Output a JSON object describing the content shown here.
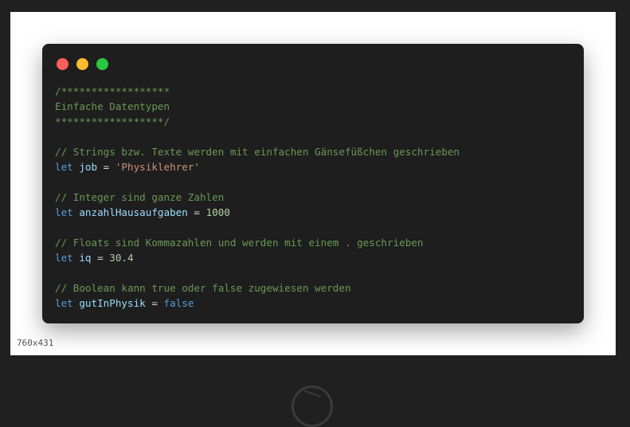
{
  "window": {
    "dots": [
      {
        "name": "close",
        "color": "#ff5f57"
      },
      {
        "name": "minimize",
        "color": "#febc2e"
      },
      {
        "name": "maximize",
        "color": "#28c840"
      }
    ]
  },
  "code": {
    "lines": [
      [
        {
          "t": "comment",
          "v": "/******************"
        }
      ],
      [
        {
          "t": "comment",
          "v": "Einfache Datentypen"
        }
      ],
      [
        {
          "t": "comment",
          "v": "******************/"
        }
      ],
      [],
      [
        {
          "t": "comment",
          "v": "// Strings bzw. Texte werden mit einfachen Gänsefüßchen geschrieben"
        }
      ],
      [
        {
          "t": "keyword",
          "v": "let"
        },
        {
          "t": "op",
          "v": " "
        },
        {
          "t": "ident",
          "v": "job"
        },
        {
          "t": "op",
          "v": " = "
        },
        {
          "t": "string",
          "v": "'Physiklehrer'"
        }
      ],
      [],
      [
        {
          "t": "comment",
          "v": "// Integer sind ganze Zahlen"
        }
      ],
      [
        {
          "t": "keyword",
          "v": "let"
        },
        {
          "t": "op",
          "v": " "
        },
        {
          "t": "ident",
          "v": "anzahlHausaufgaben"
        },
        {
          "t": "op",
          "v": " = "
        },
        {
          "t": "number",
          "v": "1000"
        }
      ],
      [],
      [
        {
          "t": "comment",
          "v": "// Floats sind Kommazahlen und werden mit einem . geschrieben"
        }
      ],
      [
        {
          "t": "keyword",
          "v": "let"
        },
        {
          "t": "op",
          "v": " "
        },
        {
          "t": "ident",
          "v": "iq"
        },
        {
          "t": "op",
          "v": " = "
        },
        {
          "t": "number",
          "v": "30.4"
        }
      ],
      [],
      [
        {
          "t": "comment",
          "v": "// Boolean kann true oder false zugewiesen werden"
        }
      ],
      [
        {
          "t": "keyword",
          "v": "let"
        },
        {
          "t": "op",
          "v": " "
        },
        {
          "t": "ident",
          "v": "gutInPhysik"
        },
        {
          "t": "op",
          "v": " = "
        },
        {
          "t": "bool",
          "v": "false"
        }
      ]
    ]
  },
  "image_size_label": "760x431"
}
